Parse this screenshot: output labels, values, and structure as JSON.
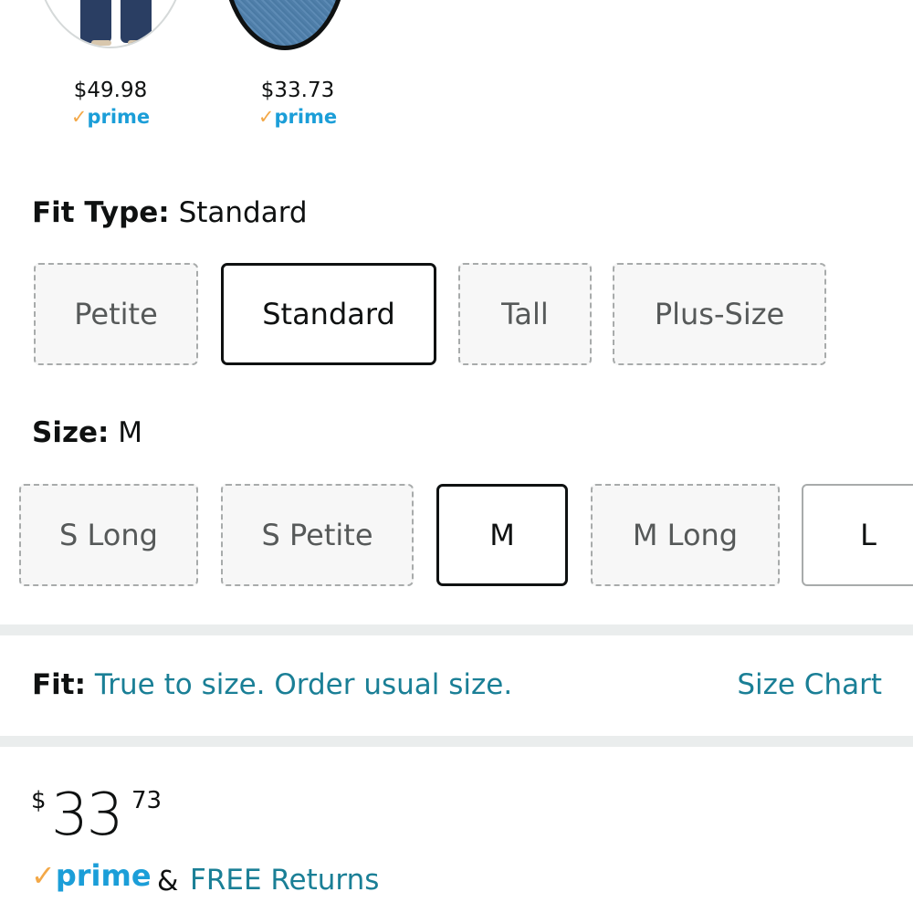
{
  "swatches": [
    {
      "price": "$49.98",
      "prime_check": "✓",
      "prime_text": "prime"
    },
    {
      "price": "$33.73",
      "prime_check": "✓",
      "prime_text": "prime"
    }
  ],
  "fit_type": {
    "label": "Fit Type:",
    "value": "Standard",
    "options": [
      "Petite",
      "Standard",
      "Tall",
      "Plus-Size"
    ],
    "selected": "Standard"
  },
  "size": {
    "label": "Size:",
    "value": "M",
    "options": [
      "S Long",
      "S Petite",
      "M",
      "M Long",
      "L"
    ],
    "selected": "M"
  },
  "fit": {
    "label": "Fit:",
    "text": "True to size. Order usual size.",
    "size_chart_link": "Size Chart"
  },
  "price": {
    "symbol": "$",
    "whole": "33",
    "fraction": "73"
  },
  "delivery": {
    "prime_check": "✓",
    "prime_text": "prime",
    "ampersand": "&",
    "returns_link": "FREE Returns"
  },
  "colors": {
    "prime_blue": "#1b9ed8",
    "prime_check": "#f3a847",
    "link_teal": "#1a7f96",
    "text": "#0f1111"
  }
}
